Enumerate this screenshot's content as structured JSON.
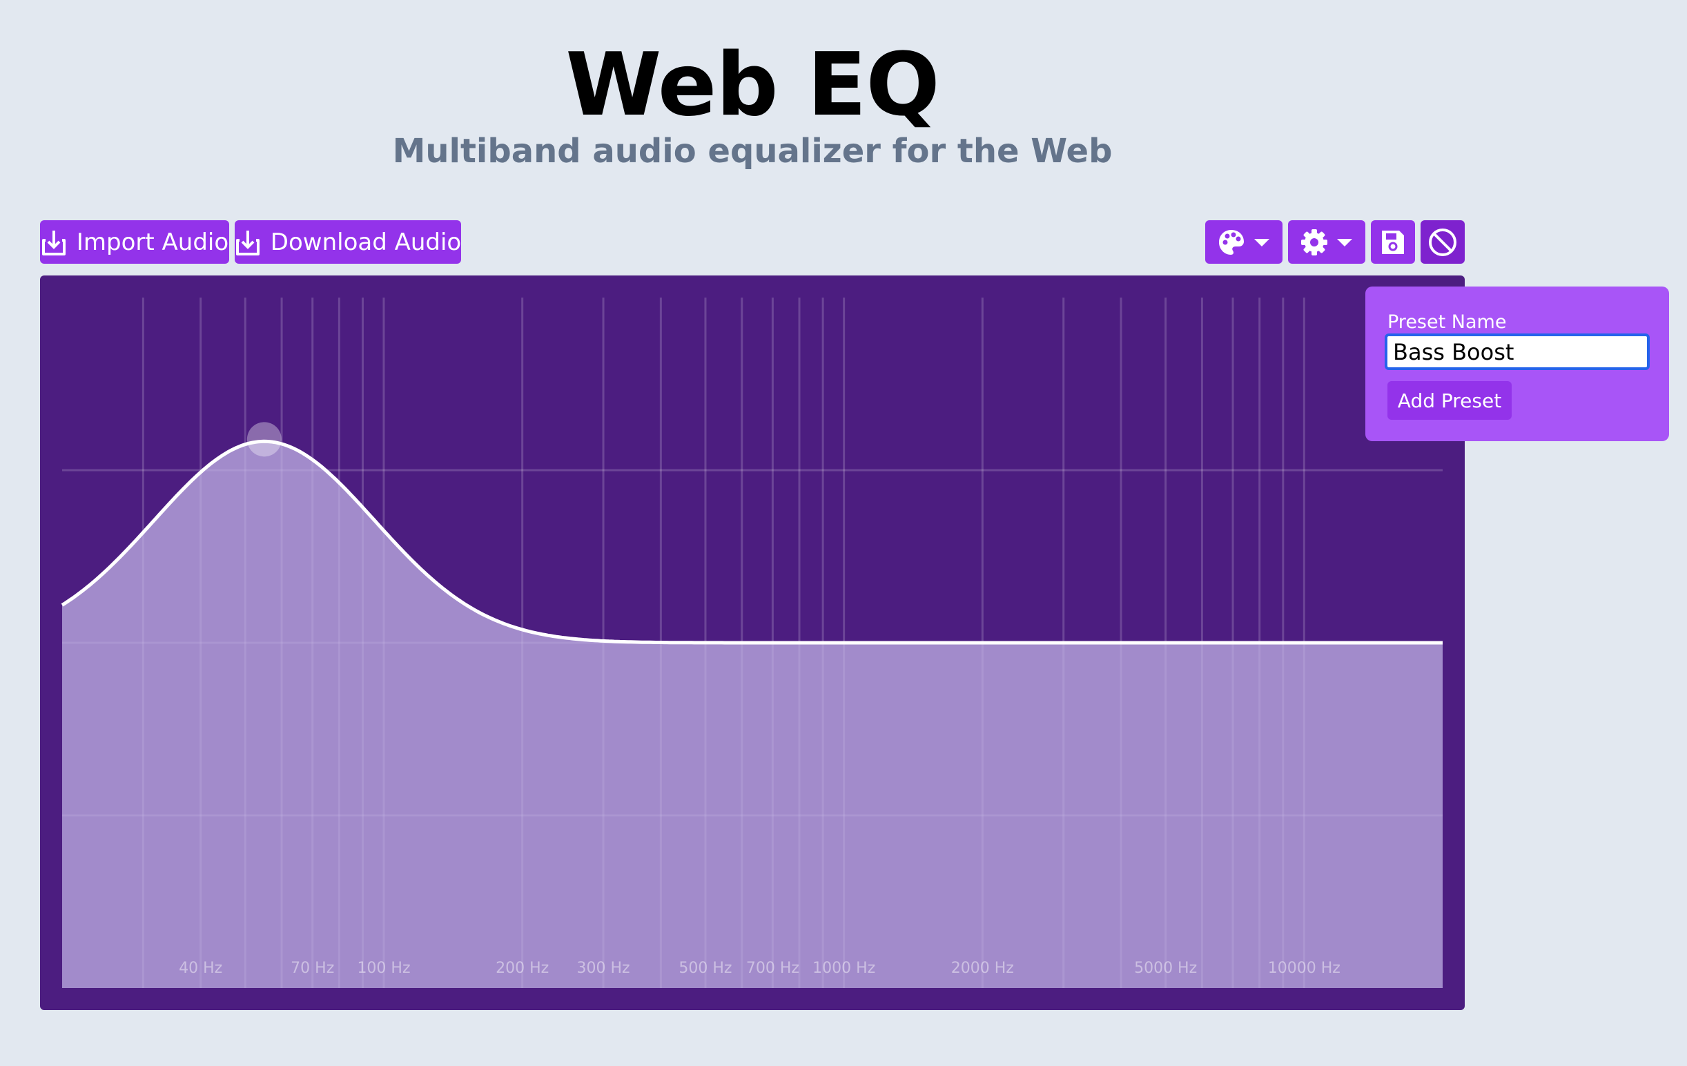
{
  "header": {
    "title": "Web EQ",
    "subtitle": "Multiband audio equalizer for the Web"
  },
  "toolbar": {
    "import_label": "Import Audio",
    "download_label": "Download Audio",
    "icons": {
      "import": "import-icon",
      "download": "download-icon",
      "palette": "palette-icon",
      "settings": "gear-icon",
      "save": "floppy-disk-icon",
      "reset": "ban-icon",
      "dropdown": "caret-down-icon"
    }
  },
  "preset_popover": {
    "label": "Preset Name",
    "input_value": "Bass Boost",
    "add_button": "Add Preset"
  },
  "chart_data": {
    "type": "area",
    "x_scale": "log",
    "x_tick_labels": [
      "40 Hz",
      "70 Hz",
      "100 Hz",
      "200 Hz",
      "300 Hz",
      "500 Hz",
      "700 Hz",
      "1000 Hz",
      "2000 Hz",
      "5000 Hz",
      "10000 Hz"
    ],
    "x_ticks": [
      40,
      70,
      100,
      200,
      300,
      500,
      700,
      1000,
      2000,
      5000,
      10000
    ],
    "xlim": [
      20,
      20000
    ],
    "ylim": [
      -24,
      24
    ],
    "grid": true,
    "bands": [
      {
        "type": "peaking",
        "frequency": 55,
        "gain": 14
      }
    ]
  },
  "colors": {
    "page_bg": "#e2e8f0",
    "accent": "#9333ea",
    "graph_bg": "#4c1d80",
    "popover_bg": "#a855f7",
    "curve": "#ffffff",
    "fill": "#9b88c0"
  }
}
